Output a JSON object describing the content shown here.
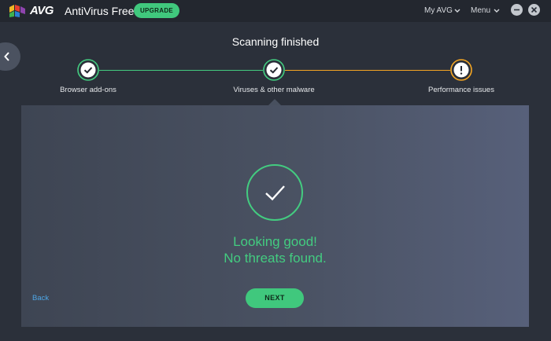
{
  "titlebar": {
    "brand": "AVG",
    "product": "AntiVirus Free",
    "upgrade_label": "UPGRADE",
    "my_avg_label": "My AVG",
    "menu_label": "Menu"
  },
  "scan": {
    "title": "Scanning finished",
    "steps": [
      {
        "label": "Browser add-ons",
        "status": "ok",
        "icon": "check-icon"
      },
      {
        "label": "Viruses & other malware",
        "status": "ok",
        "icon": "check-icon"
      },
      {
        "label": "Performance issues",
        "status": "warning",
        "icon": "exclamation-icon"
      }
    ]
  },
  "result": {
    "line1": "Looking good!",
    "line2": "No threats found.",
    "back_label": "Back",
    "next_label": "NEXT"
  },
  "colors": {
    "accent_green": "#43cc80",
    "warning_orange": "#f5a623",
    "link_blue": "#4ea6e6",
    "background": "#2b303a"
  }
}
